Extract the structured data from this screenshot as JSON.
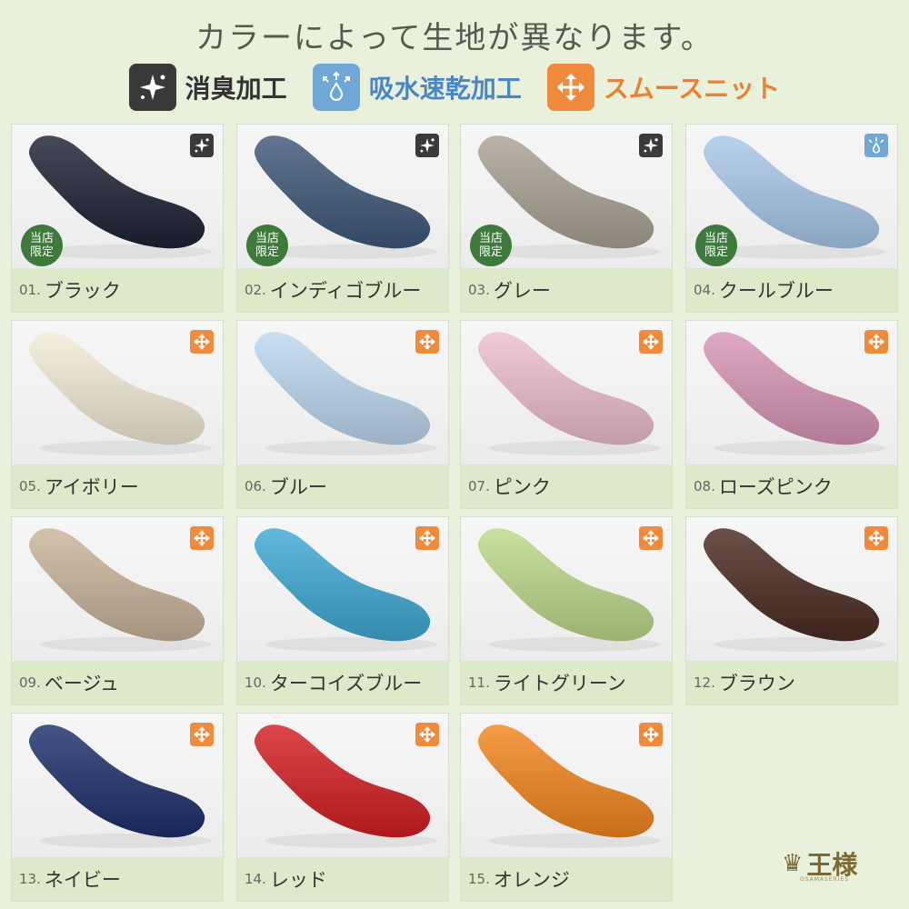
{
  "header": {
    "title": "カラーによって生地が異なります。",
    "legend": [
      {
        "label": "消臭加工",
        "icon": "sparkle-icon",
        "color": "#3a3a3a",
        "text_color": "#333333"
      },
      {
        "label": "吸水速乾加工",
        "icon": "water-drop-arrows-icon",
        "color": "#6fa7d6",
        "text_color": "#4a86c4"
      },
      {
        "label": "スムースニット",
        "icon": "four-way-arrows-icon",
        "color": "#f08a3c",
        "text_color": "#ee7f2d"
      }
    ]
  },
  "items": [
    {
      "num": "01.",
      "name": "ブラック",
      "color": "#1e2234",
      "badge": "sparkle-icon",
      "stamp": "当店限定"
    },
    {
      "num": "02.",
      "name": "インディゴブルー",
      "color": "#3e5878",
      "badge": "sparkle-icon",
      "stamp": "当店限定"
    },
    {
      "num": "03.",
      "name": "グレー",
      "color": "#a9a393",
      "badge": "sparkle-icon",
      "stamp": "当店限定"
    },
    {
      "num": "04.",
      "name": "クールブルー",
      "color": "#a9c8ea",
      "badge": "water-drop-arrows-icon",
      "stamp": "当店限定"
    },
    {
      "num": "05.",
      "name": "アイボリー",
      "color": "#f3ecd9",
      "badge": "four-way-arrows-icon",
      "stamp": ""
    },
    {
      "num": "06.",
      "name": "ブルー",
      "color": "#bcd9ee",
      "badge": "four-way-arrows-icon",
      "stamp": ""
    },
    {
      "num": "07.",
      "name": "ピンク",
      "color": "#edbfcd",
      "badge": "four-way-arrows-icon",
      "stamp": ""
    },
    {
      "num": "08.",
      "name": "ローズピンク",
      "color": "#d995b5",
      "badge": "four-way-arrows-icon",
      "stamp": ""
    },
    {
      "num": "09.",
      "name": "ベージュ",
      "color": "#c9b49a",
      "badge": "four-way-arrows-icon",
      "stamp": ""
    },
    {
      "num": "10.",
      "name": "ターコイズブルー",
      "color": "#3fa9d4",
      "badge": "four-way-arrows-icon",
      "stamp": ""
    },
    {
      "num": "11.",
      "name": "ライトグリーン",
      "color": "#bdd98a",
      "badge": "four-way-arrows-icon",
      "stamp": ""
    },
    {
      "num": "12.",
      "name": "ブラウン",
      "color": "#4a2b22",
      "badge": "four-way-arrows-icon",
      "stamp": ""
    },
    {
      "num": "13.",
      "name": "ネイビー",
      "color": "#1e2f6b",
      "badge": "four-way-arrows-icon",
      "stamp": ""
    },
    {
      "num": "14.",
      "name": "レッド",
      "color": "#d41e22",
      "badge": "four-way-arrows-icon",
      "stamp": ""
    },
    {
      "num": "15.",
      "name": "オレンジ",
      "color": "#f2861e",
      "badge": "four-way-arrows-icon",
      "stamp": ""
    }
  ],
  "brand": {
    "name": "王様",
    "sub": "OSAMASERIES",
    "icon": "crown-icon"
  }
}
